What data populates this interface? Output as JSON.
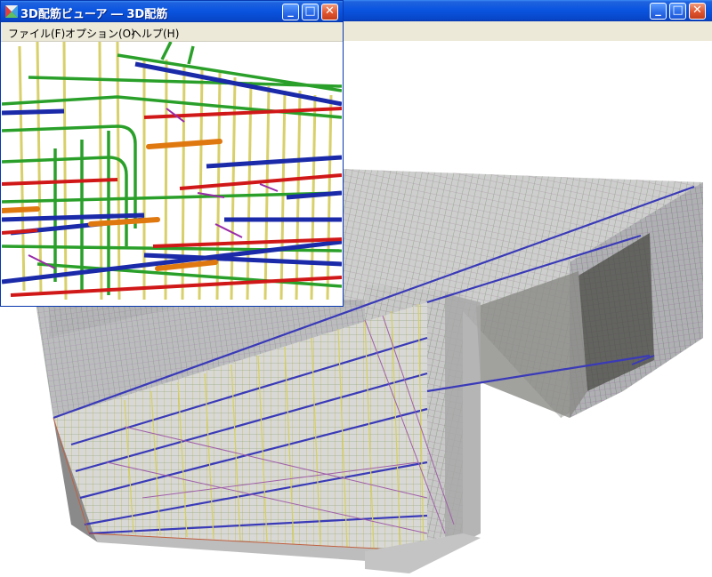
{
  "viewer_window": {
    "title": "3D配筋ビューア ― 3D配筋",
    "menu": [
      "ファイル(F)",
      "オプション(O)",
      "ヘルプ(H)"
    ],
    "buttons": {
      "minimize": "_",
      "maximize": "□",
      "close": "✕"
    }
  },
  "main_window": {
    "buttons": {
      "minimize": "_",
      "maximize": "□",
      "close": "✕"
    }
  },
  "colors": {
    "title_blue": "#0a55e0",
    "rebar_green": "#2aa02a",
    "rebar_blue": "#1a2aa8",
    "rebar_red": "#d01818",
    "rebar_yellow": "#e8e060",
    "rebar_orange": "#e07810",
    "rebar_purple": "#9a2aa8"
  }
}
